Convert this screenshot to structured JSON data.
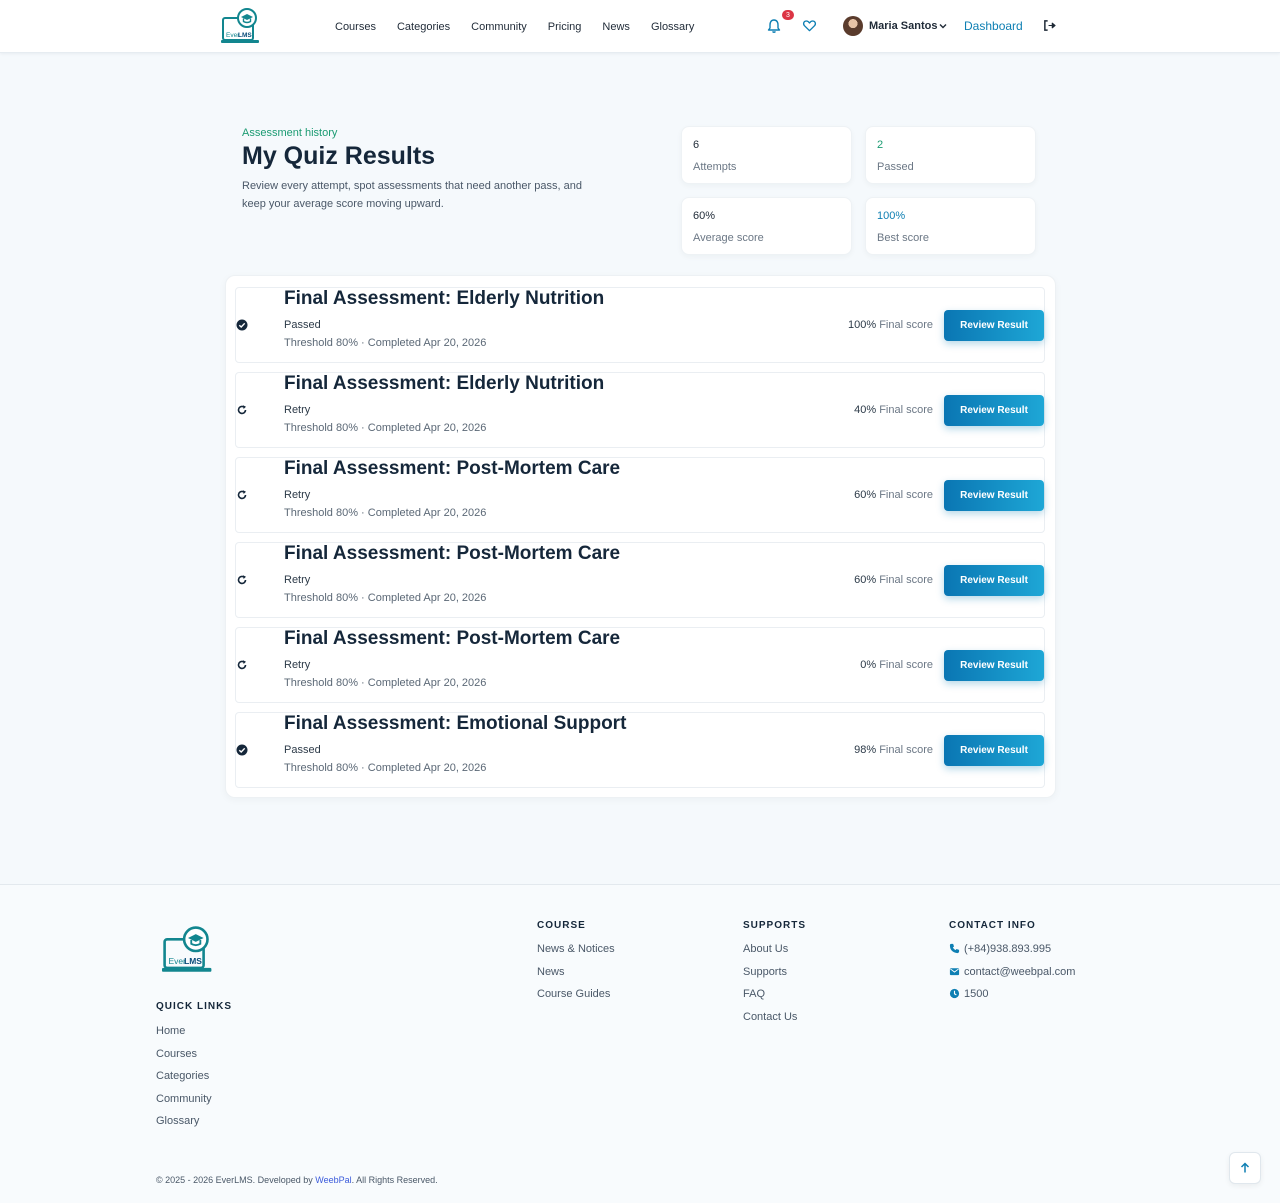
{
  "nav": {
    "links": [
      "Courses",
      "Categories",
      "Community",
      "Pricing",
      "News",
      "Glossary"
    ],
    "notification_count": "3",
    "user_name": "Maria Santos",
    "dashboard_label": "Dashboard"
  },
  "hero": {
    "eyebrow": "Assessment history",
    "title": "My Quiz Results",
    "description": "Review every attempt, spot assessments that need another pass, and keep your average score moving upward."
  },
  "stats": [
    {
      "value": "6",
      "label": "Attempts",
      "color": "#1f2a37"
    },
    {
      "value": "2",
      "label": "Passed",
      "color": "#1b9b72"
    },
    {
      "value": "60%",
      "label": "Average score",
      "color": "#1f2a37"
    },
    {
      "value": "100%",
      "label": "Best score",
      "color": "#0e7fb3"
    }
  ],
  "results": [
    {
      "title": "Final Assessment: Elderly Nutrition",
      "status": "Passed",
      "status_icon": "check-circle-icon",
      "meta": "Threshold 80% · Completed Apr 20, 2026",
      "score": "100%",
      "score_label": "Final score",
      "button": "Review Result"
    },
    {
      "title": "Final Assessment: Elderly Nutrition",
      "status": "Retry",
      "status_icon": "retry-icon",
      "meta": "Threshold 80% · Completed Apr 20, 2026",
      "score": "40%",
      "score_label": "Final score",
      "button": "Review Result"
    },
    {
      "title": "Final Assessment: Post-Mortem Care",
      "status": "Retry",
      "status_icon": "retry-icon",
      "meta": "Threshold 80% · Completed Apr 20, 2026",
      "score": "60%",
      "score_label": "Final score",
      "button": "Review Result"
    },
    {
      "title": "Final Assessment: Post-Mortem Care",
      "status": "Retry",
      "status_icon": "retry-icon",
      "meta": "Threshold 80% · Completed Apr 20, 2026",
      "score": "60%",
      "score_label": "Final score",
      "button": "Review Result"
    },
    {
      "title": "Final Assessment: Post-Mortem Care",
      "status": "Retry",
      "status_icon": "retry-icon",
      "meta": "Threshold 80% · Completed Apr 20, 2026",
      "score": "0%",
      "score_label": "Final score",
      "button": "Review Result"
    },
    {
      "title": "Final Assessment: Emotional Support",
      "status": "Passed",
      "status_icon": "check-circle-icon",
      "meta": "Threshold 80% · Completed Apr 20, 2026",
      "score": "98%",
      "score_label": "Final score",
      "button": "Review Result"
    }
  ],
  "footer": {
    "quick_links_heading": "QUICK LINKS",
    "quick_links": [
      "Home",
      "Courses",
      "Categories",
      "Community",
      "Glossary"
    ],
    "course_heading": "COURSE",
    "course_links": [
      "News & Notices",
      "News",
      "Course Guides"
    ],
    "supports_heading": "SUPPORTS",
    "supports_links": [
      "About Us",
      "Supports",
      "FAQ",
      "Contact Us"
    ],
    "contact_heading": "CONTACT INFO",
    "contact": {
      "phone": "(+84)938.893.995",
      "email": "contact@weebpal.com",
      "hours": "1500"
    },
    "copyright_prefix": "© 2025 - 2026 EverLMS. Developed by",
    "copyright_link": "WeebPal",
    "copyright_suffix": ". All Rights Reserved."
  },
  "colors": {
    "brand": "#0e7fb3",
    "accent_green": "#1b9b72",
    "logo_teal": "#12868f"
  }
}
